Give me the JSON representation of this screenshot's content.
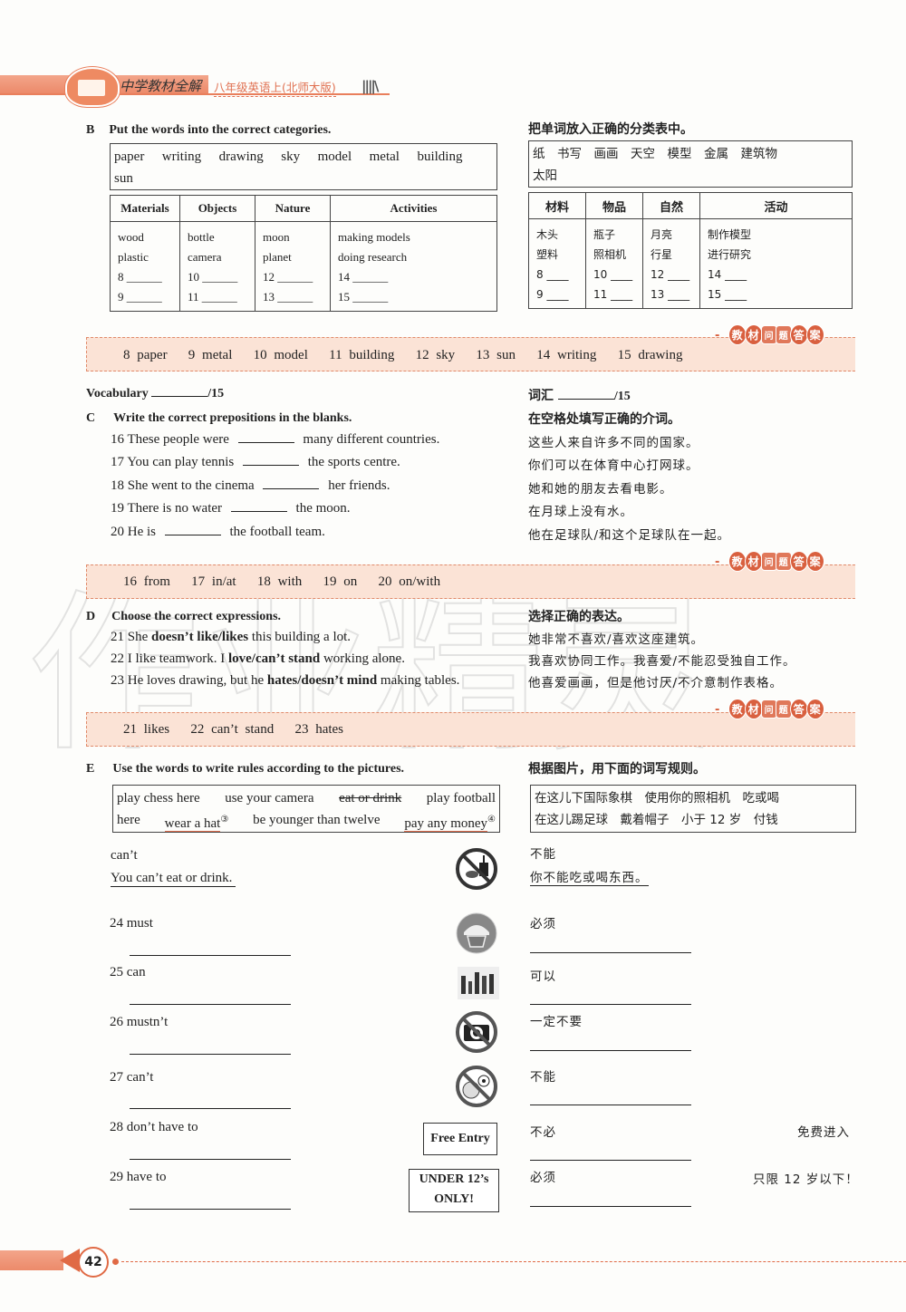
{
  "header": {
    "book_title": "中学教材全解",
    "subtitle": "八年级英语上(北师大版)",
    "bars": "||||\\"
  },
  "sectionB": {
    "letter": "B",
    "title": "Put the words into the correct categories.",
    "cn_title": "把单词放入正确的分类表中。",
    "wordbox_line1": "paper  writing  drawing  sky  model  metal  building",
    "wordbox_line2": "sun",
    "cn_wordbox_line1": "纸　书写　画画　天空　模型　金属　建筑物",
    "cn_wordbox_line2": "太阳",
    "table": {
      "headers": [
        "Materials",
        "Objects",
        "Nature",
        "Activities"
      ],
      "columns": [
        [
          "wood",
          "plastic",
          "8 ______",
          "9 ______"
        ],
        [
          "bottle",
          "camera",
          "10 ______",
          "11 ______"
        ],
        [
          "moon",
          "planet",
          "12 ______",
          "13 ______"
        ],
        [
          "making models",
          "doing research",
          "14 ______",
          "15 ______"
        ]
      ]
    },
    "cn_table": {
      "headers": [
        "材料",
        "物品",
        "自然",
        "活动"
      ],
      "columns": [
        [
          "木头",
          "塑料",
          "8 ____",
          "9 ____"
        ],
        [
          "瓶子",
          "照相机",
          "10 ____",
          "11 ____"
        ],
        [
          "月亮",
          "行星",
          "12 ____",
          "13 ____"
        ],
        [
          "制作模型",
          "进行研究",
          "14 ____",
          "15 ____"
        ]
      ]
    },
    "answer": "8 paper   9 metal   10 model   11 building   12 sky   13 sun   14 writing   15 drawing"
  },
  "answer_badge": {
    "lead": "-",
    "chars": [
      "教",
      "材",
      "问",
      "题",
      "答",
      "案"
    ]
  },
  "vocabulary": {
    "label": "Vocabulary",
    "score": "/15",
    "cn_label": "词汇",
    "cn_score": "/15"
  },
  "sectionC": {
    "letter": "C",
    "title": "Write the correct prepositions in the blanks.",
    "cn_title": "在空格处填写正确的介词。",
    "items": [
      {
        "pre": "16 These people were",
        "post": "many different countries."
      },
      {
        "pre": "17 You can play tennis",
        "post": "the sports centre."
      },
      {
        "pre": "18 She went to the cinema",
        "post": "her friends."
      },
      {
        "pre": "19 There is no water",
        "post": "the moon."
      },
      {
        "pre": "20 He is",
        "post": "the football team."
      }
    ],
    "cn_items": [
      "这些人来自许多不同的国家。",
      "你们可以在体育中心打网球。",
      "她和她的朋友去看电影。",
      "在月球上没有水。",
      "他在足球队/和这个足球队在一起。"
    ],
    "answer": "16 from   17 in/at   18 with   19 on   20 on/with"
  },
  "sectionD": {
    "letter": "D",
    "title": "Choose the correct expressions.",
    "cn_title": "选择正确的表达。",
    "items": [
      {
        "pre": "21 She ",
        "bold": "doesn’t like/likes",
        "post": " this building a lot."
      },
      {
        "pre": "22 I like teamwork. I ",
        "bold": "love/can’t stand",
        "post": " working alone."
      },
      {
        "pre": "23 He loves drawing, but he ",
        "bold": "hates/doesn’t mind",
        "post": " making tables."
      }
    ],
    "cn_items": [
      "她非常不喜欢/喜欢这座建筑。",
      "我喜欢协同工作。我喜爱/不能忍受独自工作。",
      "他喜爱画画，但是他讨厌/不介意制作表格。"
    ],
    "answer": "21 likes   22 can’t stand   23 hates"
  },
  "sectionE": {
    "letter": "E",
    "title": "Use the words to write rules according to the pictures.",
    "cn_title": "根据图片，用下面的词写规则。",
    "wordbox": {
      "w1": "play chess here",
      "w2": "use your camera",
      "w3": "eat or drink",
      "w4": "play football",
      "w5": "here",
      "w6": "wear a hat",
      "w6_note": "③",
      "w7": "be younger than twelve",
      "w8": "pay any money",
      "w8_note": "④"
    },
    "cn_wordbox_line1": "在这儿下国际象棋　使用你的照相机　吃或喝",
    "cn_wordbox_line2": "在这儿踢足球　戴着帽子　小于 12 岁　付钱",
    "example": {
      "modal": "can’t",
      "sentence": "You can’t eat or drink.",
      "cn_modal": "不能",
      "cn_sentence": "你不能吃或喝东西。",
      "icon": "no-eating-drinking-icon"
    },
    "items": [
      {
        "label": "24 must",
        "cn": "必须",
        "icon": "hard-hat-icon"
      },
      {
        "label": "25 can",
        "cn": "可以",
        "icon": "chess-icon"
      },
      {
        "label": "26 mustn’t",
        "cn": "一定不要",
        "icon": "no-camera-icon"
      },
      {
        "label": "27 can’t",
        "cn": "不能",
        "icon": "no-ball-games-icon"
      },
      {
        "label": "28 don’t have to",
        "cn": "不必",
        "sign": "Free Entry",
        "cn_sign": "免费进入"
      },
      {
        "label": "29 have to",
        "cn": "必须",
        "sign_line1": "UNDER 12’s",
        "sign_line2": "ONLY!",
        "cn_sign": "只限 12 岁以下！"
      }
    ]
  },
  "watermark": "作业精灵",
  "footer": {
    "page_number": "42"
  }
}
